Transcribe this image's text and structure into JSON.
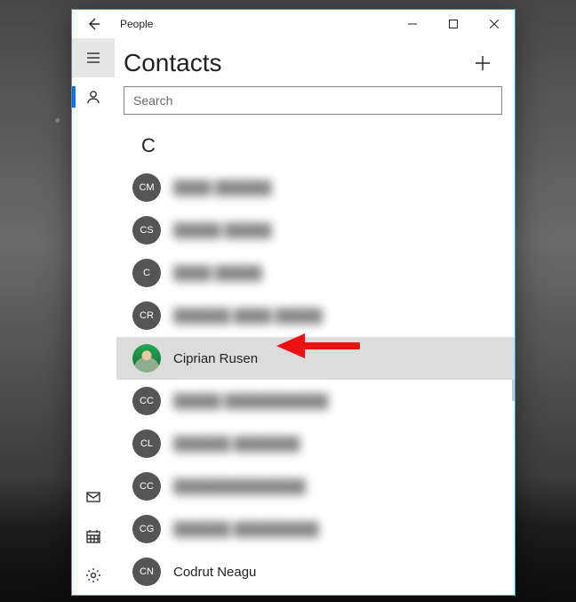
{
  "titlebar": {
    "app_name": "People"
  },
  "header": {
    "title": "Contacts"
  },
  "search": {
    "placeholder": "Search",
    "value": ""
  },
  "rail": {
    "items": [
      {
        "key": "hamburger",
        "icon": "hamburger-icon"
      },
      {
        "key": "people",
        "icon": "person-icon",
        "active": true
      }
    ],
    "bottom_items": [
      {
        "key": "mail",
        "icon": "mail-icon"
      },
      {
        "key": "calendar",
        "icon": "calendar-icon"
      },
      {
        "key": "settings",
        "icon": "gear-icon"
      }
    ]
  },
  "groups": [
    {
      "letter": "C",
      "items": [
        {
          "initials": "CM",
          "name": "████ ██████",
          "redacted": true
        },
        {
          "initials": "CS",
          "name": "█████ █████",
          "redacted": true
        },
        {
          "initials": "C",
          "name": "████ █████",
          "redacted": true
        },
        {
          "initials": "CR",
          "name": "██████ ████ █████",
          "redacted": true
        },
        {
          "initials": "",
          "name": "Ciprian Rusen",
          "redacted": false,
          "photo": true,
          "selected": true
        },
        {
          "initials": "CC",
          "name": "█████ ███████████",
          "redacted": true
        },
        {
          "initials": "CL",
          "name": "██████ ███████",
          "redacted": true
        },
        {
          "initials": "CC",
          "name": "██████████████",
          "redacted": true
        },
        {
          "initials": "CG",
          "name": "██████ █████████",
          "redacted": true
        },
        {
          "initials": "CN",
          "name": "Codrut Neagu",
          "redacted": false
        }
      ]
    }
  ],
  "annotation": {
    "arrow_color": "#e22"
  }
}
